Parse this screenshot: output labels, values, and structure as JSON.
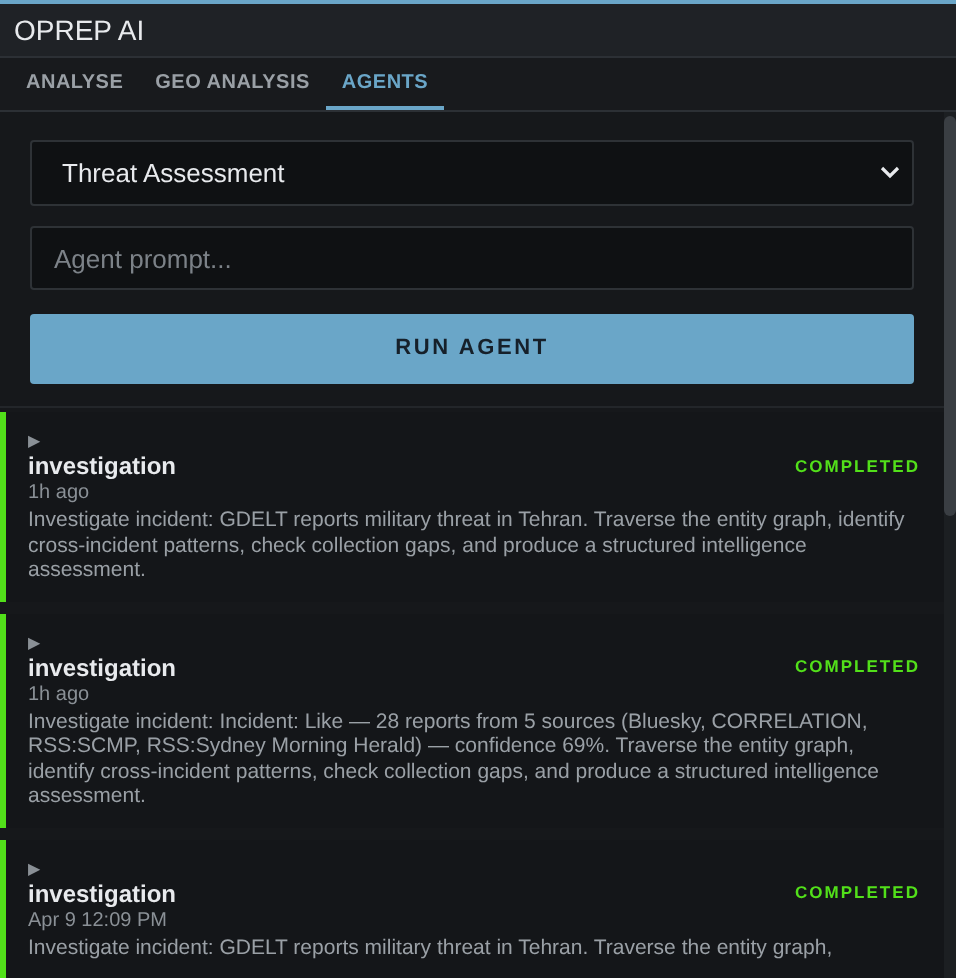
{
  "window": {
    "title": "OPREP AI"
  },
  "tabs": [
    {
      "label": "ANALYSE",
      "selected": false
    },
    {
      "label": "GEO ANALYSIS",
      "selected": false
    },
    {
      "label": "AGENTS",
      "selected": true
    }
  ],
  "agent_select": {
    "value": "Threat Assessment"
  },
  "prompt": {
    "placeholder": "Agent prompt..."
  },
  "run_button": {
    "label": "RUN AGENT"
  },
  "runs": [
    {
      "marker": "▶",
      "type": "investigation",
      "status": "COMPLETED",
      "color": "#52e01a",
      "time": "1h ago",
      "text": "Investigate incident: GDELT reports military threat in Tehran. Traverse the entity graph, identify cross-incident patterns, check collection gaps, and produce a structured intelligence assessment."
    },
    {
      "marker": "▶",
      "type": "investigation",
      "status": "COMPLETED",
      "color": "#52e01a",
      "time": "1h ago",
      "text": "Investigate incident: Incident: Like — 28 reports from 5 sources (Bluesky, CORRELATION, RSS:SCMP, RSS:Sydney Morning Herald) — confidence 69%. Traverse the entity graph, identify cross-incident patterns, check collection gaps, and produce a structured intelligence assessment."
    },
    {
      "marker": "▶",
      "type": "investigation",
      "status": "COMPLETED",
      "color": "#52e01a",
      "time": "Apr 9 12:09 PM",
      "text": "Investigate incident: GDELT reports military threat in Tehran. Traverse the entity graph,"
    }
  ]
}
